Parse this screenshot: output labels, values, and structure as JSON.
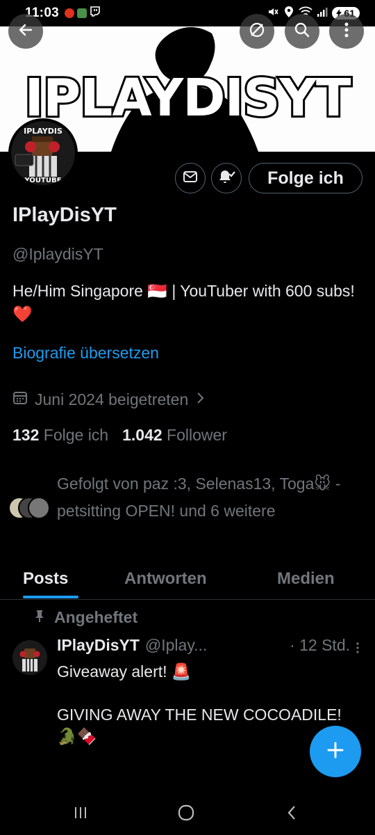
{
  "status_bar": {
    "time": "11:03",
    "battery": "61",
    "left_icons": [
      "record-dot-icon",
      "app-icon",
      "twitch-icon"
    ],
    "right_icons": [
      "mute-icon",
      "location-icon",
      "wifi-icon",
      "signal-icon",
      "battery-icon"
    ]
  },
  "banner": {
    "title": "IPLAYDISYT"
  },
  "top_bar": {
    "icons": [
      "back-arrow-icon",
      "grok-icon",
      "search-icon",
      "more-vertical-icon"
    ]
  },
  "profile": {
    "avatar_text_top": "IPLAYDIS",
    "avatar_text_bottom": "YOUTUBE",
    "follow_label": "Folge ich",
    "display_name": "IPlayDisYT",
    "handle": "@IplaydisYT",
    "bio": "He/Him Singapore 🇸🇬 | YouTuber with 600 subs! ❤️",
    "translate_label": "Biografie übersetzen",
    "joined": "Juni 2024 beigetreten",
    "following_count": "132",
    "following_label": "Folge ich",
    "followers_count": "1.042",
    "followers_label": "Follower",
    "followed_by": "Gefolgt von paz :3, Selenas13, Toga🐭 - petsitting OPEN! und 6 weitere"
  },
  "tabs": [
    {
      "label": "Posts",
      "active": true
    },
    {
      "label": "Antworten",
      "active": false
    },
    {
      "label": "Medien",
      "active": false
    }
  ],
  "post": {
    "pinned_label": "Angeheftet",
    "name": "IPlayDisYT",
    "handle": "@Iplay...",
    "time": "· 12 Std.",
    "text": "Giveaway alert! 🚨\n\nGIVING AWAY THE NEW COCOADILE! 🐊🍫"
  },
  "colors": {
    "accent": "#1d9bf0",
    "secondary_text": "#71767b",
    "primary_text": "#e7e9ea",
    "background": "#000000"
  }
}
